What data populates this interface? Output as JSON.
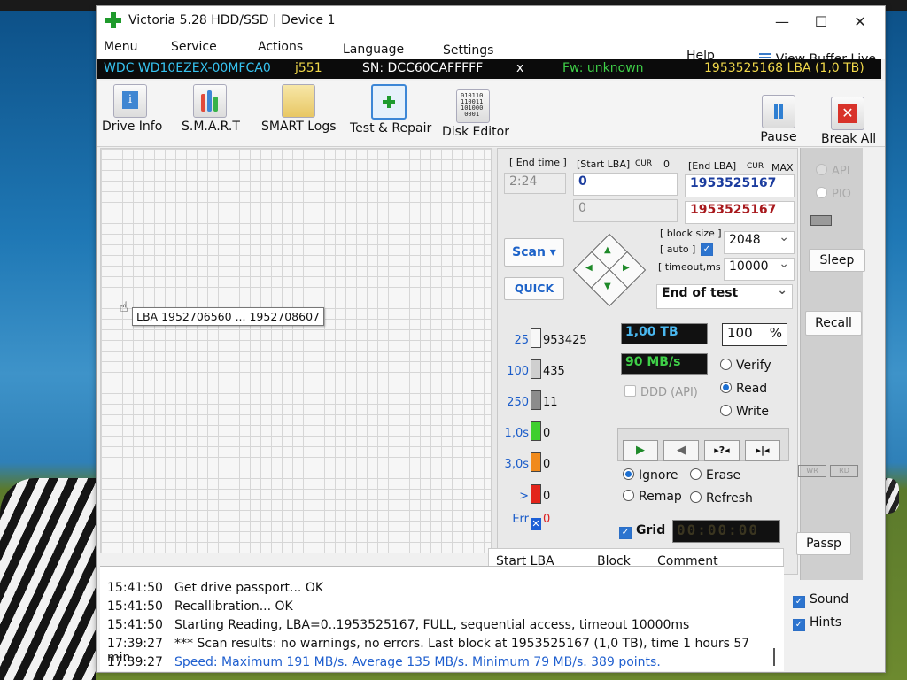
{
  "window": {
    "title": "Victoria 5.28 HDD/SSD | Device 1",
    "controls": {
      "minimize": "—",
      "maximize": "☐",
      "close": "✕"
    }
  },
  "menu": {
    "items": [
      "Menu",
      "Service",
      "Actions",
      "Language",
      "Settings"
    ],
    "help": "Help",
    "view_buffer": "View Buffer Live"
  },
  "drive_info": {
    "model": "WDC WD10EZEX-00MFCA0",
    "rev": "j551",
    "serial": "SN: DCC60CAFFFFF",
    "close": "x",
    "firmware": "Fw: unknown",
    "lba": "1953525168 LBA (1,0 TB)"
  },
  "toolbar": {
    "tools": [
      "Drive Info",
      "S.M.A.R.T",
      "SMART Logs",
      "Test & Repair",
      "Disk Editor"
    ],
    "pause": "Pause",
    "break_all": "Break All",
    "disk_editor_bits": "010110\n110011\n101000\n0001"
  },
  "map": {
    "tooltip": "LBA  1952706560 ... 1952708607"
  },
  "test": {
    "end_time_label": "[ End time ]",
    "end_time": "2:24",
    "start_lba_label": "[Start LBA]",
    "cur": "CUR",
    "zero": "0",
    "end_lba_label": "[End LBA]",
    "max": "MAX",
    "start_lba": "0",
    "start_lba2": "0",
    "end_lba": "1953525167",
    "end_lba2": "1953525167",
    "scan_button": "Scan",
    "quick_button": "QUICK",
    "block_size_label": "[ block size ]",
    "auto_label": "[ auto ]",
    "block_size": "2048",
    "timeout_label": "[ timeout,ms ]",
    "timeout": "10000",
    "end_action": "End of test"
  },
  "stats": {
    "rows": [
      {
        "label": "25",
        "value": "953425",
        "color": "#f7f7f7"
      },
      {
        "label": "100",
        "value": "435",
        "color": "#cfcfcf"
      },
      {
        "label": "250",
        "value": "11",
        "color": "#8c8c8c"
      },
      {
        "label": "1,0s",
        "value": "0",
        "color": "#3fcf2e"
      },
      {
        "label": "3,0s",
        "value": "0",
        "color": "#f08a1c"
      },
      {
        "label": ">",
        "value": "0",
        "color": "#e3241b"
      },
      {
        "label": "Err",
        "value": "0",
        "color": "#1c5fd6"
      }
    ],
    "err_mark": "✕",
    "size": "1,00 TB",
    "percent": "100",
    "percent_sign": "%",
    "speed": "90 MB/s",
    "ddd": "DDD (API)",
    "verify": "Verify",
    "read": "Read",
    "write": "Write",
    "ignore": "Ignore",
    "erase": "Erase",
    "remap": "Remap",
    "refresh": "Refresh",
    "grid": "Grid",
    "timer": "00:00:00",
    "play_buttons": [
      "▶",
      "◀",
      "▸?◂",
      "▸|◂"
    ]
  },
  "right_panel": {
    "api": "API",
    "pio": "PIO",
    "sleep": "Sleep",
    "recall": "Recall",
    "wr": "WR",
    "rd": "RD",
    "passp": "Passp"
  },
  "columns": [
    "Start LBA",
    "Block",
    "Comment"
  ],
  "log": [
    {
      "time": "15:41:50",
      "text": "Get drive passport... OK",
      "color": "#111111"
    },
    {
      "time": "15:41:50",
      "text": "Recallibration... OK",
      "color": "#111111"
    },
    {
      "time": "15:41:50",
      "text": "Starting Reading, LBA=0..1953525167, FULL, sequential access, timeout 10000ms",
      "color": "#111111"
    },
    {
      "time": "17:39:27",
      "text": "*** Scan results: no warnings, no errors. Last block at 1953525167 (1,0 TB), time 1 hours 57 min...",
      "color": "#111111"
    },
    {
      "time": "17:39:27",
      "text": "Speed: Maximum 191 MB/s. Average 135 MB/s. Minimum 79 MB/s. 389 points.",
      "color": "#1f5fcf"
    }
  ],
  "log_options": {
    "sound": "Sound",
    "hints": "Hints"
  }
}
